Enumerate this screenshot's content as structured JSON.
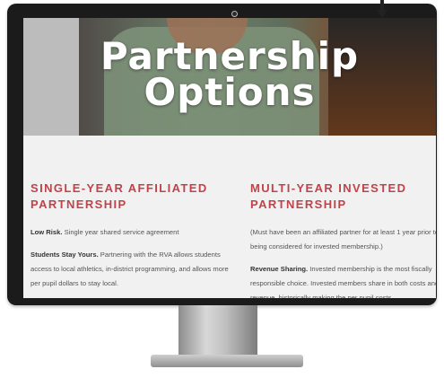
{
  "hero": {
    "title_line1": "Partnership",
    "title_line2": "Options"
  },
  "left_column": {
    "heading_line1": "SINGLE-YEAR AFFILIATED",
    "heading_line2": "PARTNERSHIP",
    "p1_bold": "Low Risk.",
    "p1_text": " Single year shared service agreement",
    "p2_bold": "Students Stay Yours.",
    "p2_text": " Partnering with the RVA allows students access to local athletics, in-district programming, and allows more per pupil dollars to stay local."
  },
  "right_column": {
    "heading_line1": "MULTI-YEAR INVESTED",
    "heading_line2": "PARTNERSHIP",
    "p1_text": "(Must have been an affiliated partner for at least 1 year prior to being considered for invested membership.)",
    "p2_bold": "Revenue Sharing.",
    "p2_text": " Invested membership is the most fiscally responsible choice. Invested members share in both costs and revenue, historically making the per pupil costs"
  },
  "colors": {
    "accent": "#c0434a",
    "body_text": "#555555",
    "screen_bg": "#f1f1f2",
    "bezel": "#1b1b1c"
  },
  "icons": {
    "arrow": "arrow-down-icon",
    "camera": "webcam-icon"
  }
}
